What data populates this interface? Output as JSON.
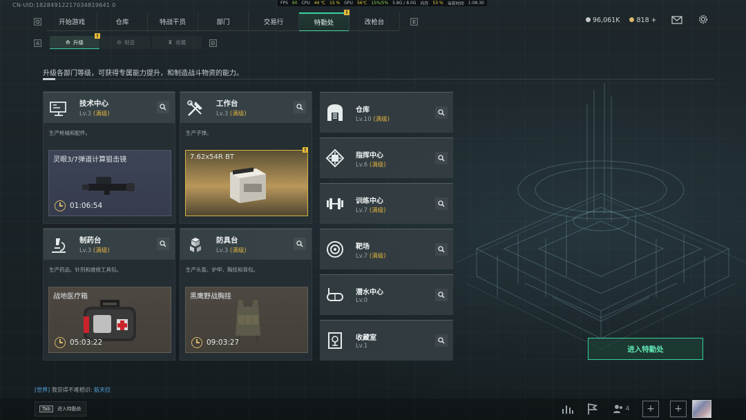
{
  "uid": "CN-UID:18284912217034819641 0",
  "perf": {
    "fps_label": "FPS",
    "fps": "60",
    "cpu_label": "CPU",
    "cpu_temp": "44 ℃",
    "cpu_use": "15 %",
    "gpu_label": "GPU",
    "gpu_temp": "56℃",
    "gpu_use": "15%/5%",
    "vram": "5.8G / 8.0G",
    "mem_label": "内存",
    "mem": "53 %",
    "time_label": "当前时间",
    "time": "1:08:30"
  },
  "nav": {
    "left_key": "Q",
    "right_key": "E",
    "tabs": [
      {
        "label": "开始游戏"
      },
      {
        "label": "仓库"
      },
      {
        "label": "特战干员"
      },
      {
        "label": "部门"
      },
      {
        "label": "交易行"
      },
      {
        "label": "特勤处"
      },
      {
        "label": "改枪台"
      }
    ],
    "active_tab": "特勤处",
    "badge": "!"
  },
  "currency": {
    "silver": "96,061K",
    "gold": "818 +"
  },
  "subtabs": {
    "left_key": "A",
    "right_key": "D",
    "items": [
      {
        "label": "升级"
      },
      {
        "label": "制造"
      },
      {
        "label": "收藏"
      }
    ],
    "active": "升级",
    "badge": "!"
  },
  "description": "升级各部门等级，可获得专属能力提升，和制造战斗物资的能力。",
  "big_cards": [
    {
      "title": "技术中心",
      "lv_prefix": "Lv.3",
      "lv_status": "(满级)",
      "sub": "生产枪械和配件。",
      "item": "灵眼3/7弹道计算狙击镜",
      "timer": "01:06:54",
      "icon": "computer-icon"
    },
    {
      "title": "工作台",
      "lv_prefix": "Lv.3",
      "lv_status": "(满级)",
      "sub": "生产子弹。",
      "item": "7.62x54R BT",
      "timer": "",
      "icon": "tools-icon",
      "badge": "!"
    },
    {
      "title": "制药台",
      "lv_prefix": "Lv.3",
      "lv_status": "(满级)",
      "sub": "生产药品、针剂和维修工具包。",
      "item": "战地医疗箱",
      "timer": "05:03:22",
      "icon": "microscope-icon"
    },
    {
      "title": "防具台",
      "lv_prefix": "Lv.3",
      "lv_status": "(满级)",
      "sub": "生产头盔、护甲、胸挂和背包。",
      "item": "黑鹰野战胸挂",
      "timer": "09:03:27",
      "icon": "armor-blocks-icon"
    }
  ],
  "small_cards": [
    {
      "title": "仓库",
      "lv_prefix": "Lv.10",
      "lv_status": "(满级)",
      "icon": "warehouse-icon"
    },
    {
      "title": "指挥中心",
      "lv_prefix": "Lv.6",
      "lv_status": "(满级)",
      "icon": "command-chip-icon"
    },
    {
      "title": "训练中心",
      "lv_prefix": "Lv.7",
      "lv_status": "(满级)",
      "icon": "dumbbell-icon"
    },
    {
      "title": "靶场",
      "lv_prefix": "Lv.7",
      "lv_status": "(满级)",
      "icon": "target-icon"
    },
    {
      "title": "潜水中心",
      "lv_prefix": "Lv.0",
      "lv_status": "",
      "icon": "dive-mask-icon"
    },
    {
      "title": "收藏室",
      "lv_prefix": "Lv.1",
      "lv_status": "",
      "icon": "trophy-case-icon"
    }
  ],
  "enter_button": "进入特勤处",
  "chat": {
    "channel": "[世界]",
    "message": "我觉得不难相识:",
    "name": "航天拉"
  },
  "hint": {
    "key": "Tab",
    "label": "进入特勤处"
  },
  "bottom_right": {
    "friends_count": "4"
  },
  "colors": {
    "accent": "#38d39f",
    "gold": "#e0b23f"
  }
}
